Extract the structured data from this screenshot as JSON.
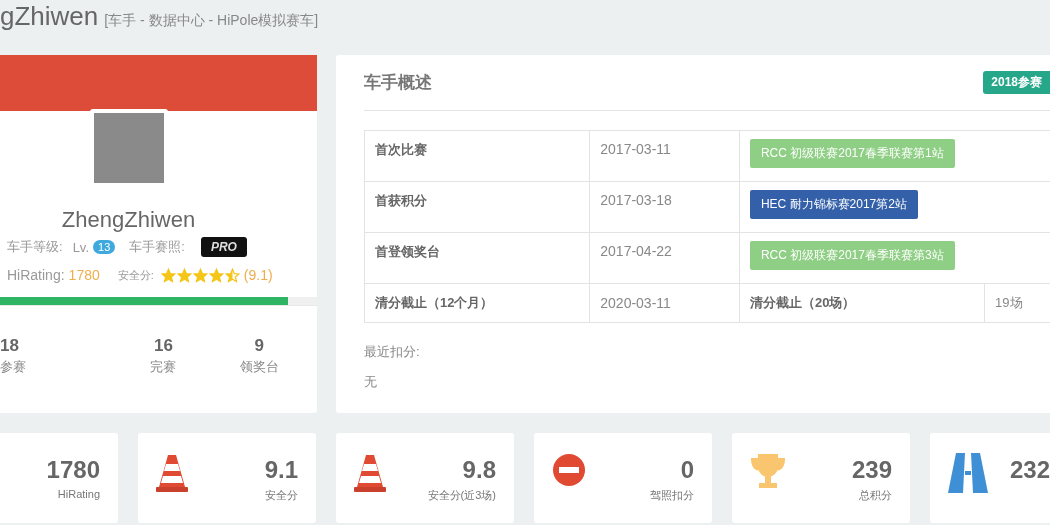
{
  "page_title": {
    "name": "gZhiwen",
    "subtitle": "[车手 - 数据中心 - HiPole模拟赛车]"
  },
  "profile": {
    "name": "ZhengZhiwen",
    "level_label": "车手等级:",
    "level_prefix": "Lv.",
    "level": "13",
    "license_label": "车手赛照:",
    "license": "PRO",
    "rating_label": "HiRating:",
    "rating": "1780",
    "safety_label": "安全分:",
    "stars": 4.5,
    "safety_value": "(9.1)",
    "progress": {
      "level": 0.91
    },
    "stats": [
      {
        "value": "18",
        "label": "参赛"
      },
      {
        "value": "16",
        "label": "完赛"
      },
      {
        "value": "9",
        "label": "领奖台"
      }
    ]
  },
  "overview": {
    "title": "车手概述",
    "badge": "2018参赛",
    "rows": [
      {
        "kind": "event",
        "label": "首次比赛",
        "date": "2017-03-11",
        "event": "RCC 初级联赛2017春季联赛第1站",
        "color": "#8fcf85"
      },
      {
        "kind": "event",
        "label": "首获积分",
        "date": "2017-03-18",
        "event": "HEC 耐力锦标赛2017第2站",
        "color": "#3360a9"
      },
      {
        "kind": "event",
        "label": "首登领奖台",
        "date": "2017-04-22",
        "event": "RCC 初级联赛2017春季联赛第3站",
        "color": "#8fcf85"
      },
      {
        "kind": "cutoff",
        "label": "清分截止（12个月）",
        "date": "2020-03-11",
        "label2": "清分截止（20场）",
        "value2": "19场"
      }
    ],
    "recent_label": "最近扣分:",
    "recent_value": "无"
  },
  "stat_cards": [
    {
      "kind": "none",
      "value": "1780",
      "label": "HiRating"
    },
    {
      "kind": "cone",
      "value": "9.1",
      "label": "安全分"
    },
    {
      "kind": "cone",
      "value": "9.8",
      "label": "安全分(近3场)"
    },
    {
      "kind": "no-entry",
      "value": "0",
      "label": "驾照扣分"
    },
    {
      "kind": "trophy",
      "value": "239",
      "label": "总积分"
    },
    {
      "kind": "road",
      "value": "232"
    }
  ]
}
